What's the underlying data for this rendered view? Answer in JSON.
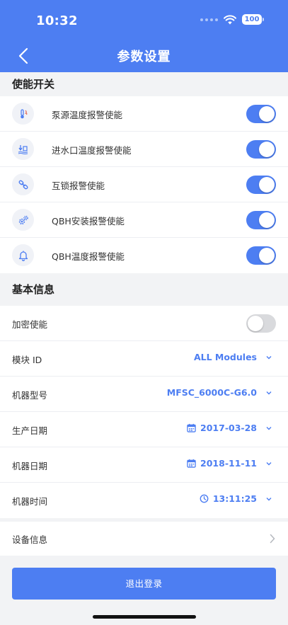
{
  "status_bar": {
    "time": "10:32",
    "battery": "100"
  },
  "nav": {
    "title": "参数设置"
  },
  "sections": {
    "enable_switches": "使能开关",
    "basic_info": "基本信息"
  },
  "switches": [
    {
      "label": "泵源温度报警使能",
      "icon": "thermometer-flame-icon",
      "on": true
    },
    {
      "label": "进水口温度报警使能",
      "icon": "water-inlet-icon",
      "on": true
    },
    {
      "label": "互锁报警使能",
      "icon": "link-icon",
      "on": true
    },
    {
      "label": "QBH安装报警使能",
      "icon": "gears-icon",
      "on": true
    },
    {
      "label": "QBH温度报警使能",
      "icon": "bell-icon",
      "on": true
    }
  ],
  "basic": {
    "encrypt": {
      "label": "加密使能",
      "on": false
    },
    "module": {
      "label": "模块 ID",
      "value": "ALL Modules"
    },
    "model": {
      "label": "机器型号",
      "value": "MFSC_6000C-G6.0"
    },
    "production_date": {
      "label": "生产日期",
      "value": "2017-03-28"
    },
    "machine_date": {
      "label": "机器日期",
      "value": "2018-11-11"
    },
    "machine_time": {
      "label": "机器时间",
      "value": "13:11:25"
    }
  },
  "device_info": {
    "label": "设备信息"
  },
  "logout": {
    "label": "退出登录"
  },
  "colors": {
    "accent": "#4d7ef2",
    "background": "#f2f3f5",
    "toggle_off": "#d9dadd"
  }
}
